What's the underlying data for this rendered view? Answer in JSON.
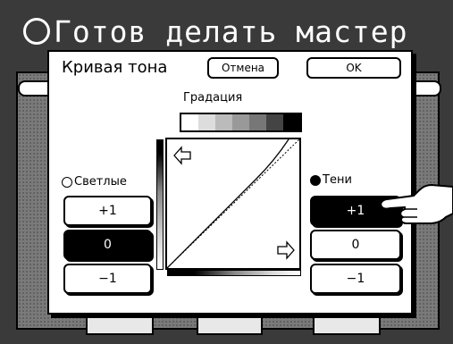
{
  "screen_title": "Готов делать мастер",
  "dialog": {
    "title": "Кривая тона",
    "cancel_label": "Отмена",
    "ok_label": "OK"
  },
  "gradation": {
    "label": "Градация"
  },
  "highlights": {
    "label": "Светлые",
    "buttons": [
      "+1",
      "0",
      "−1"
    ],
    "selected": "0"
  },
  "shadows": {
    "label": "Тени",
    "buttons": [
      "+1",
      "0",
      "−1"
    ],
    "selected": "+1"
  },
  "icons": {
    "highlights_icon": "sun-outline-icon",
    "shadows_icon": "sun-filled-icon",
    "curve_arrow_top": "arrow-left-icon",
    "curve_arrow_bottom": "arrow-right-icon",
    "pointer": "pointing-hand-icon"
  },
  "colors": {
    "background": "#3a3a3a",
    "dialog": "#ffffff",
    "selected_button": "#000000"
  }
}
